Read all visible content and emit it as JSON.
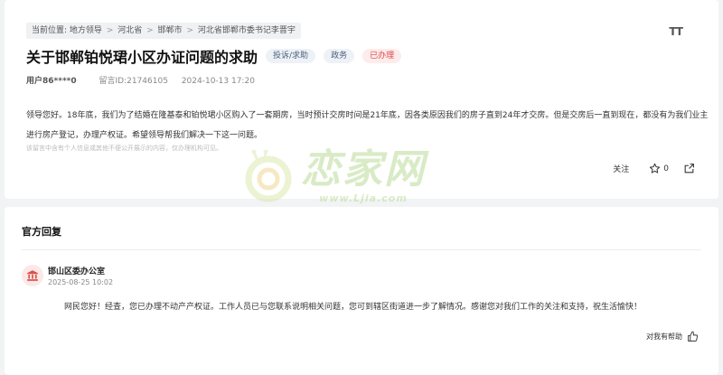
{
  "breadcrumb": {
    "prefix": "当前位置:",
    "items": [
      "地方领导",
      "河北省",
      "邯郸市",
      "河北省邯郸市委书记李晋宇"
    ],
    "separator": ">"
  },
  "toolbar": {
    "font_size_glyph": "TT"
  },
  "post": {
    "title": "关于邯郸铂悦珺小区办证问题的求助",
    "tags": {
      "category": "投诉/求助",
      "department": "政务",
      "status": "已办理"
    },
    "user": "用户86****0",
    "message_id": "留言ID:21746105",
    "datetime": "2024-10-13 17:20",
    "content": "领导您好。18年底，我们为了结婚在隆基泰和铂悦珺小区购入了一套期房，当时预计交房时间是21年底，因各类原因我们的房子直到24年才交房。但是交房后一直到现在，都没有为我们业主进行房产登记，办理产权证。希望领导帮我们解决一下这一问题。",
    "notice": "该留言中含有个人信息或其他不便公开展示的内容，仅办理机构可见。",
    "follow_label": "关注",
    "like_count": "0"
  },
  "watermark": {
    "brand": "恋家网",
    "url": "www.Ljia.com"
  },
  "official": {
    "section_title": "官方回复",
    "org_name": "邯山区委办公室",
    "reply_date": "2025-08-25 10:02",
    "reply_text": "网民您好！经查，您已办理不动产产权证。工作人员已与您联系说明相关问题，您可到辖区街道进一步了解情况。感谢您对我们工作的关注和支持，祝生活愉快！",
    "helpful_label": "对我有帮助"
  },
  "colors": {
    "status_red": "#e04848",
    "tag_blue": "#4a5f7a",
    "watermark_green": "#b5d98f",
    "org_icon_red": "#d9534f"
  },
  "icons": [
    "font-size-icon",
    "star-icon",
    "share-icon",
    "government-building-icon",
    "thumbs-up-icon",
    "snail-logo-icon"
  ]
}
